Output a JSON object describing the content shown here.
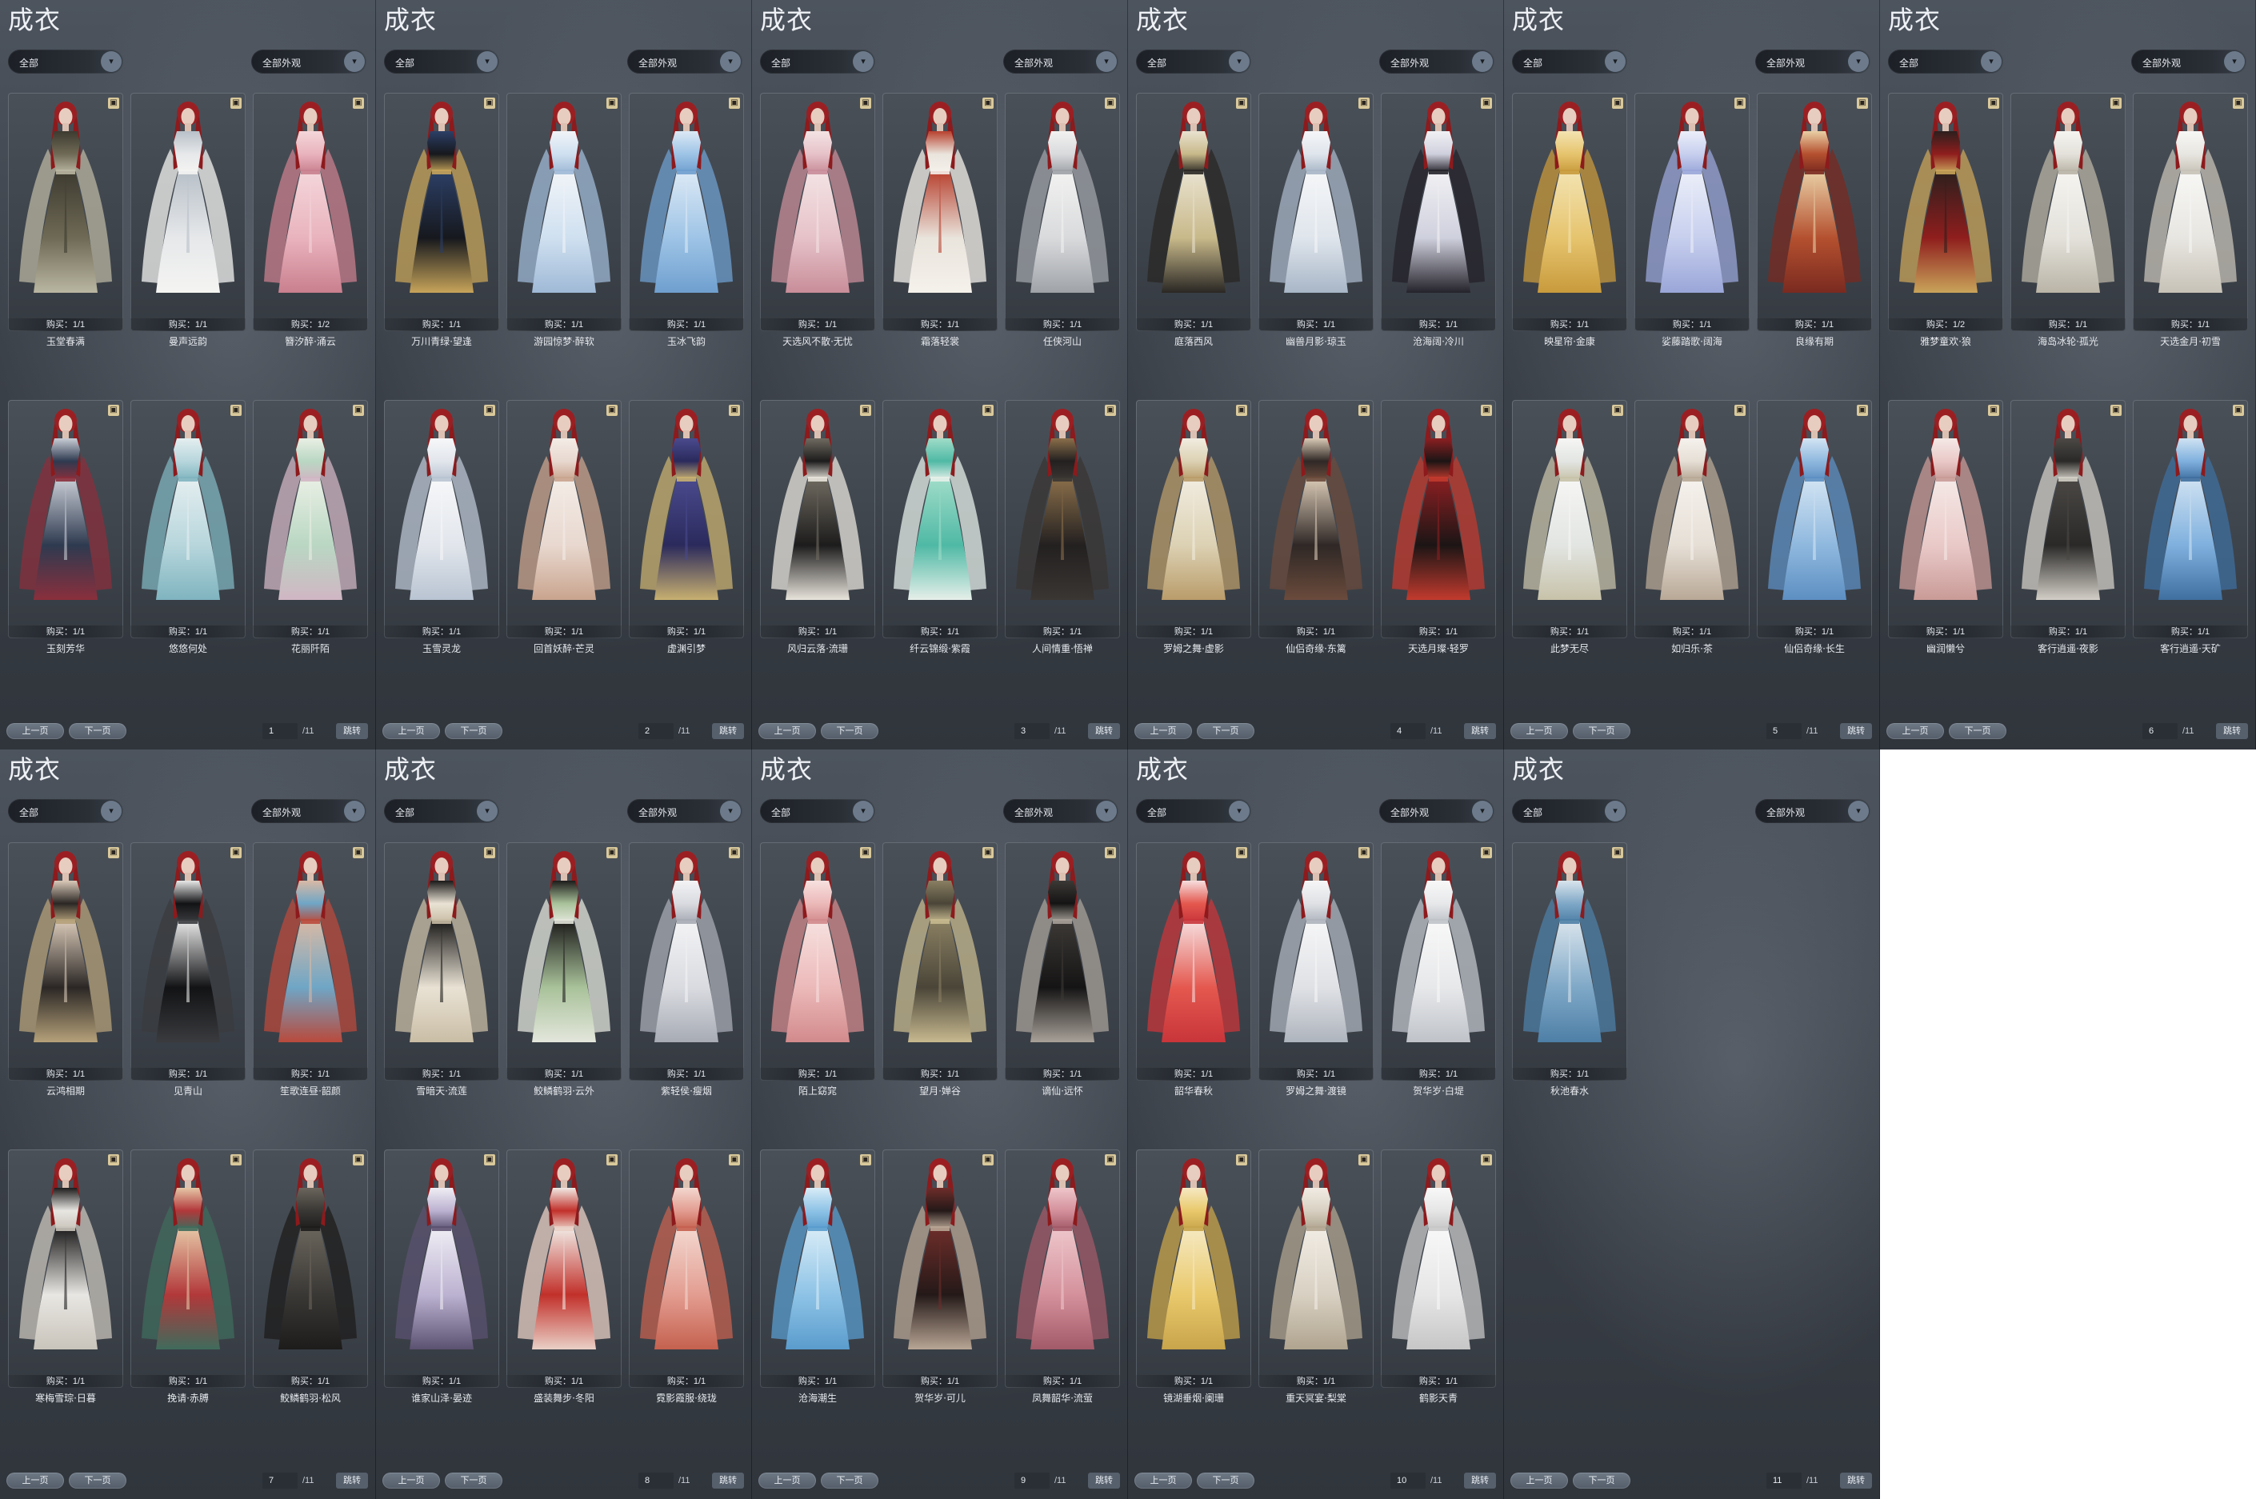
{
  "pages": [
    {
      "title": "成衣",
      "filter_left": "全部",
      "filter_right": "全部外观",
      "page": "1",
      "total": "/11",
      "prev": "上一页",
      "next": "下一页",
      "jump": "跳转",
      "items": [
        {
          "buy": "购买：1/1",
          "name": "玉堂春满",
          "palette": [
            "#6f6a55",
            "#3d3a30",
            "#b9b6a2"
          ]
        },
        {
          "buy": "购买：1/1",
          "name": "曼声远韵",
          "palette": [
            "#e6e8ea",
            "#b8c0c8",
            "#f4f4f2"
          ]
        },
        {
          "buy": "购买：1/2",
          "name": "簪汐醉·涌云",
          "palette": [
            "#e9b3bd",
            "#f4d6da",
            "#c97f8e"
          ]
        },
        {
          "buy": "购买：1/1",
          "name": "玉刻芳华",
          "palette": [
            "#2e3a50",
            "#c9cdd5",
            "#8a2f3c"
          ]
        },
        {
          "buy": "购买：1/1",
          "name": "悠悠何处",
          "palette": [
            "#b7d6dc",
            "#e4eef0",
            "#7fb4bf"
          ]
        },
        {
          "buy": "购买：1/1",
          "name": "花丽阡陌",
          "palette": [
            "#b9d7c3",
            "#e9efe4",
            "#d0b6c3"
          ]
        }
      ]
    },
    {
      "title": "成衣",
      "filter_left": "全部",
      "filter_right": "全部外观",
      "page": "2",
      "total": "/11",
      "prev": "上一页",
      "next": "下一页",
      "jump": "跳转",
      "items": [
        {
          "buy": "购买：1/1",
          "name": "万川青绿·望逢",
          "palette": [
            "#16181d",
            "#2c3f66",
            "#c7a45a"
          ]
        },
        {
          "buy": "购买：1/1",
          "name": "游园惊梦·醉软",
          "palette": [
            "#cfe0f0",
            "#f1f4f8",
            "#9fb9d6"
          ]
        },
        {
          "buy": "购买：1/1",
          "name": "玉冰飞韵",
          "palette": [
            "#9ec4e6",
            "#dce9f5",
            "#6f9fcf"
          ]
        },
        {
          "buy": "购买：1/1",
          "name": "玉雪灵龙",
          "palette": [
            "#e2e6ec",
            "#f6f7f9",
            "#b9c4d2"
          ]
        },
        {
          "buy": "购买：1/1",
          "name": "回首妖醉·芒灵",
          "palette": [
            "#e8d8cf",
            "#f3ece6",
            "#c9a48e"
          ]
        },
        {
          "buy": "购买：1/1",
          "name": "虚渊引梦",
          "palette": [
            "#2b2a5c",
            "#4a4a8e",
            "#c8b070"
          ]
        }
      ]
    },
    {
      "title": "成衣",
      "filter_left": "全部",
      "filter_right": "全部外观",
      "page": "3",
      "total": "/11",
      "prev": "上一页",
      "next": "下一页",
      "jump": "跳转",
      "items": [
        {
          "buy": "购买：1/1",
          "name": "天选风不散·无忧",
          "palette": [
            "#e6c2c8",
            "#f3e3e4",
            "#c88d99"
          ]
        },
        {
          "buy": "购买：1/1",
          "name": "霜落轻裳",
          "palette": [
            "#e9e4dc",
            "#b8412f",
            "#f5f1eb"
          ]
        },
        {
          "buy": "购买：1/1",
          "name": "任侠河山",
          "palette": [
            "#d9dadc",
            "#f2f2f1",
            "#9fa3a8"
          ]
        },
        {
          "buy": "购买：1/1",
          "name": "风归云落·流珊",
          "palette": [
            "#1d1c1c",
            "#6f6a60",
            "#e8e4dc"
          ]
        },
        {
          "buy": "购买：1/1",
          "name": "纤云锦缎·紫霞",
          "palette": [
            "#4fb9a5",
            "#9fdcc8",
            "#e6efe9"
          ]
        },
        {
          "buy": "购买：1/1",
          "name": "人间情重·悟禅",
          "palette": [
            "#232020",
            "#8a6e4a",
            "#3a3633"
          ]
        }
      ]
    },
    {
      "title": "成衣",
      "filter_left": "全部",
      "filter_right": "全部外观",
      "page": "4",
      "total": "/11",
      "prev": "上一页",
      "next": "下一页",
      "jump": "跳转",
      "items": [
        {
          "buy": "购买：1/1",
          "name": "庭落西风",
          "palette": [
            "#c8b98a",
            "#e9e2cf",
            "#2a2724"
          ]
        },
        {
          "buy": "购买：1/1",
          "name": "幽兽月影·琼玉",
          "palette": [
            "#dfe5ec",
            "#f5f6f8",
            "#a8b6c7"
          ]
        },
        {
          "buy": "购买：1/1",
          "name": "沧海阔·冷川",
          "palette": [
            "#cfd0dd",
            "#f1f1f4",
            "#24222a"
          ]
        },
        {
          "buy": "购买：1/1",
          "name": "罗姆之舞·虚影",
          "palette": [
            "#dcd1b3",
            "#f1ece0",
            "#b99c6a"
          ]
        },
        {
          "buy": "购买：1/1",
          "name": "仙侣奇缘·东篱",
          "palette": [
            "#2f2826",
            "#d9c9b5",
            "#6b4b3c"
          ]
        },
        {
          "buy": "购买：1/1",
          "name": "天选月璨·轻罗",
          "palette": [
            "#1c1515",
            "#8b1f22",
            "#c23a2e"
          ]
        }
      ]
    },
    {
      "title": "成衣",
      "filter_left": "全部",
      "filter_right": "全部外观",
      "page": "5",
      "total": "/11",
      "prev": "上一页",
      "next": "下一页",
      "jump": "跳转",
      "items": [
        {
          "buy": "购买：1/1",
          "name": "映星帘·金康",
          "palette": [
            "#e6c46e",
            "#f3e3b1",
            "#c89a3c"
          ]
        },
        {
          "buy": "购买：1/1",
          "name": "娑藤踏歌·阔海",
          "palette": [
            "#c7cfee",
            "#eceff9",
            "#9aa6d8"
          ]
        },
        {
          "buy": "购买：1/1",
          "name": "良缘有期",
          "palette": [
            "#b4502f",
            "#e9cfa5",
            "#7a2a20"
          ]
        },
        {
          "buy": "购买：1/1",
          "name": "此梦无尽",
          "palette": [
            "#e2e5e2",
            "#f6f6f4",
            "#c7c2a9"
          ]
        },
        {
          "buy": "购买：1/1",
          "name": "如归乐·茶",
          "palette": [
            "#e6dfd6",
            "#f5f1ec",
            "#b8a896"
          ]
        },
        {
          "buy": "购买：1/1",
          "name": "仙侣奇缘·长生",
          "palette": [
            "#8fb8de",
            "#d2e4f3",
            "#5d8fc2"
          ]
        }
      ]
    },
    {
      "title": "成衣",
      "filter_left": "全部",
      "filter_right": "全部外观",
      "page": "6",
      "total": "/11",
      "prev": "上一页",
      "next": "下一页",
      "jump": "跳转",
      "items": [
        {
          "buy": "购买：1/2",
          "name": "雅梦童欢·狼",
          "palette": [
            "#8f1e1d",
            "#2c1f1d",
            "#c9a45a"
          ]
        },
        {
          "buy": "购买：1/1",
          "name": "海岛冰轮·孤光",
          "palette": [
            "#e3e1da",
            "#f5f4f0",
            "#b9b4a6"
          ]
        },
        {
          "buy": "购买：1/1",
          "name": "天选金月·初雪",
          "palette": [
            "#e8e6e1",
            "#f7f7f5",
            "#c7c2b7"
          ]
        },
        {
          "buy": "购买：1/1",
          "name": "幽润懒兮",
          "palette": [
            "#e9c9c8",
            "#f5e9e6",
            "#c99b97"
          ]
        },
        {
          "buy": "购买：1/1",
          "name": "客行逍遥·夜影",
          "palette": [
            "#2a2928",
            "#4b4845",
            "#d3cfc7"
          ]
        },
        {
          "buy": "购买：1/1",
          "name": "客行逍遥·天矿",
          "palette": [
            "#7fb0de",
            "#cfe2f2",
            "#3f6f9f"
          ]
        }
      ]
    },
    {
      "title": "成衣",
      "filter_left": "全部",
      "filter_right": "全部外观",
      "page": "7",
      "total": "/11",
      "prev": "上一页",
      "next": "下一页",
      "jump": "跳转",
      "items": [
        {
          "buy": "购买：1/1",
          "name": "云鸿相期",
          "palette": [
            "#2b2725",
            "#d9c9b8",
            "#b5a17a"
          ]
        },
        {
          "buy": "购买：1/1",
          "name": "见青山",
          "palette": [
            "#121315",
            "#e8e8e8",
            "#3a3b3e"
          ]
        },
        {
          "buy": "购买：1/1",
          "name": "笙歌连昼·韶颜",
          "palette": [
            "#6fa6c6",
            "#d8b9a5",
            "#b94a3c"
          ]
        },
        {
          "buy": "购买：1/1",
          "name": "寒梅雪琮·日暮",
          "palette": [
            "#e8e6e2",
            "#1d1c1c",
            "#c9c4bb"
          ]
        },
        {
          "buy": "购买：1/1",
          "name": "挽请·赤膊",
          "palette": [
            "#b2383a",
            "#e6c7a6",
            "#3f6b5c"
          ]
        },
        {
          "buy": "购买：1/1",
          "name": "鲛鳞鹤羽·松风",
          "palette": [
            "#3a3835",
            "#6a655c",
            "#1d1c1b"
          ]
        }
      ]
    },
    {
      "title": "成衣",
      "filter_left": "全部",
      "filter_right": "全部外观",
      "page": "8",
      "total": "/11",
      "prev": "上一页",
      "next": "下一页",
      "jump": "跳转",
      "items": [
        {
          "buy": "购买：1/1",
          "name": "雪暗天·流莲",
          "palette": [
            "#e9e2d4",
            "#1b1a19",
            "#c9bda5"
          ]
        },
        {
          "buy": "购买：1/1",
          "name": "鲛鳞鹤羽·云外",
          "palette": [
            "#a9c29a",
            "#1c1b1a",
            "#e3e6dc"
          ]
        },
        {
          "buy": "购买：1/1",
          "name": "紫轻侯·瘦烟",
          "palette": [
            "#d9dbe0",
            "#f3f3f5",
            "#a7abb4"
          ]
        },
        {
          "buy": "购买：1/1",
          "name": "谁家山泽·晏迹",
          "palette": [
            "#bcb2d1",
            "#efedf4",
            "#5b5170"
          ]
        },
        {
          "buy": "购买：1/1",
          "name": "盛装舞步·冬阳",
          "palette": [
            "#c2302a",
            "#f1e9e4",
            "#e9d0c6"
          ]
        },
        {
          "buy": "购买：1/1",
          "name": "霓影霞服·绕珑",
          "palette": [
            "#e39d91",
            "#f3d7cf",
            "#c5614f"
          ]
        }
      ]
    },
    {
      "title": "成衣",
      "filter_left": "全部",
      "filter_right": "全部外观",
      "page": "9",
      "total": "/11",
      "prev": "上一页",
      "next": "下一页",
      "jump": "跳转",
      "items": [
        {
          "buy": "购买：1/1",
          "name": "陌上窈窕",
          "palette": [
            "#ecb9b9",
            "#f6e1df",
            "#d28a8c"
          ]
        },
        {
          "buy": "购买：1/1",
          "name": "望月·婵谷",
          "palette": [
            "#4a4538",
            "#8a7f62",
            "#c7b98f"
          ]
        },
        {
          "buy": "购买：1/1",
          "name": "谪仙·远怀",
          "palette": [
            "#151414",
            "#3c3936",
            "#a8a199"
          ]
        },
        {
          "buy": "购买：1/1",
          "name": "沧海潮生",
          "palette": [
            "#8ec3e6",
            "#d8ecf7",
            "#5a9ccd"
          ]
        },
        {
          "buy": "购买：1/1",
          "name": "贺华岁·可儿",
          "palette": [
            "#241918",
            "#6d2d2a",
            "#b8a594"
          ]
        },
        {
          "buy": "购买：1/1",
          "name": "凤舞韶华·流萤",
          "palette": [
            "#d4919c",
            "#eec6cb",
            "#a25a68"
          ]
        }
      ]
    },
    {
      "title": "成衣",
      "filter_left": "全部",
      "filter_right": "全部外观",
      "page": "10",
      "total": "/11",
      "prev": "上一页",
      "next": "下一页",
      "jump": "跳转",
      "items": [
        {
          "buy": "购买：1/1",
          "name": "韶华春秋",
          "palette": [
            "#e4584f",
            "#f6dede",
            "#c9353a"
          ]
        },
        {
          "buy": "购买：1/1",
          "name": "罗姆之舞·渡镜",
          "palette": [
            "#dfe1e5",
            "#f6f6f7",
            "#aeb4bd"
          ]
        },
        {
          "buy": "购买：1/1",
          "name": "贺华岁·白堤",
          "palette": [
            "#e7e8ea",
            "#f8f8f8",
            "#bfc3c9"
          ]
        },
        {
          "buy": "购买：1/1",
          "name": "镜湖垂烟·阑珊",
          "palette": [
            "#e9c96c",
            "#f6e9c2",
            "#c8a44a"
          ]
        },
        {
          "buy": "购买：1/1",
          "name": "重天冥宴·梨棠",
          "palette": [
            "#d8d0c2",
            "#f1ece4",
            "#b0a48f"
          ]
        },
        {
          "buy": "购买：1/1",
          "name": "鹤影天青",
          "palette": [
            "#e6e6e6",
            "#f8f8f8",
            "#c6c6c6"
          ]
        }
      ]
    },
    {
      "title": "成衣",
      "filter_left": "全部",
      "filter_right": "全部外观",
      "page": "11",
      "total": "/11",
      "prev": "上一页",
      "next": "下一页",
      "jump": "跳转",
      "items": [
        {
          "buy": "购买：1/1",
          "name": "秋池春水",
          "palette": [
            "#7fa8c7",
            "#d9e4ec",
            "#4e7fa6"
          ]
        }
      ]
    }
  ],
  "icons": {
    "lock": "lock-icon",
    "dropdown": "chevron-down-icon"
  }
}
